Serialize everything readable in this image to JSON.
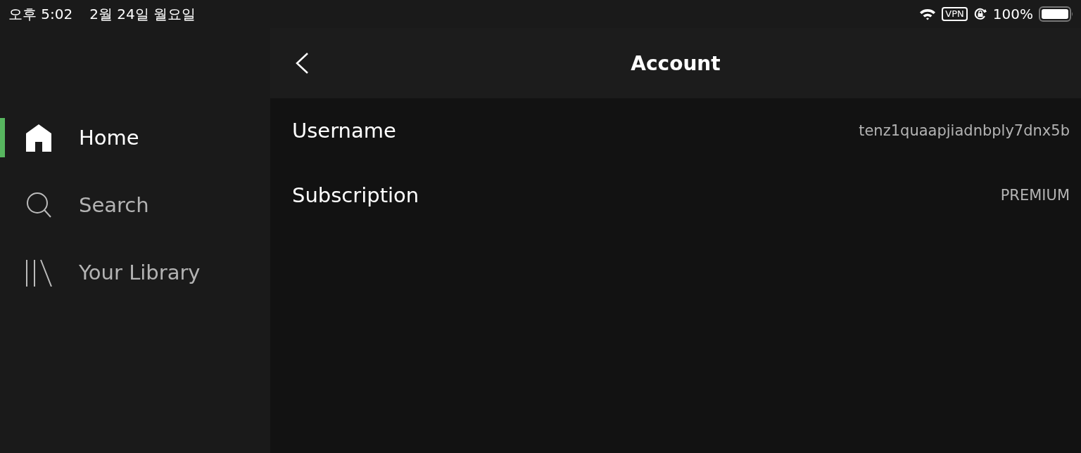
{
  "status_bar": {
    "time": "오후 5:02",
    "date": "2월 24일 월요일",
    "vpn": "VPN",
    "battery_text": "100%"
  },
  "sidebar": {
    "items": [
      {
        "label": "Home",
        "selected": true
      },
      {
        "label": "Search",
        "selected": false
      },
      {
        "label": "Your Library",
        "selected": false
      }
    ]
  },
  "header": {
    "title": "Account"
  },
  "rows": [
    {
      "label": "Username",
      "value": "tenz1quaapjiadnbply7dnx5b"
    },
    {
      "label": "Subscription",
      "value": "PREMIUM"
    }
  ]
}
